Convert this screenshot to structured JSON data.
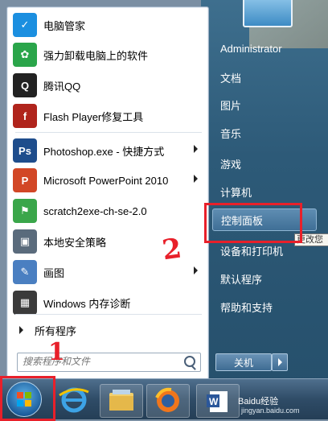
{
  "programs": [
    {
      "label": "电脑管家",
      "icon": "shield-icon",
      "color": "#1b8fe0",
      "arrow": false
    },
    {
      "label": "强力卸载电脑上的软件",
      "icon": "colorful-flower-icon",
      "color": "#2aa54a",
      "arrow": false
    },
    {
      "label": "腾讯QQ",
      "icon": "qq-penguin-icon",
      "color": "#222222",
      "arrow": false
    },
    {
      "label": "Flash Player修复工具",
      "icon": "flash-icon",
      "color": "#b0241c",
      "arrow": false
    },
    {
      "label": "Photoshop.exe - 快捷方式",
      "icon": "photoshop-icon",
      "color": "#1e4d8c",
      "arrow": true
    },
    {
      "label": "Microsoft PowerPoint 2010",
      "icon": "powerpoint-icon",
      "color": "#d24726",
      "arrow": true
    },
    {
      "label": "scratch2exe-ch-se-2.0",
      "icon": "green-flag-icon",
      "color": "#3aa64a",
      "arrow": false
    },
    {
      "label": "本地安全策略",
      "icon": "security-policy-icon",
      "color": "#5a6b7c",
      "arrow": false
    },
    {
      "label": "画图",
      "icon": "paint-palette-icon",
      "color": "#4a7fc1",
      "arrow": true
    },
    {
      "label": "Windows 内存诊断",
      "icon": "memory-chip-icon",
      "color": "#3b3b3b",
      "arrow": false
    }
  ],
  "all_programs": "所有程序",
  "search_placeholder": "搜索程序和文件",
  "right_items": [
    {
      "label": "Administrator"
    },
    {
      "label": "文档"
    },
    {
      "label": "图片"
    },
    {
      "label": "音乐"
    },
    {
      "label": "游戏"
    },
    {
      "label": "计算机"
    },
    {
      "label": "控制面板"
    },
    {
      "label": "设备和打印机"
    },
    {
      "label": "默认程序"
    },
    {
      "label": "帮助和支持"
    }
  ],
  "tooltip": "更改您",
  "shutdown_label": "关机",
  "taskbar": [
    "start-orb",
    "internet-explorer-icon",
    "file-explorer-icon",
    "firefox-icon",
    "word-icon"
  ],
  "annotations": {
    "one": "1",
    "two": "2"
  },
  "watermark": "Baidu经验",
  "watermark_url": "jingyan.baidu.com"
}
